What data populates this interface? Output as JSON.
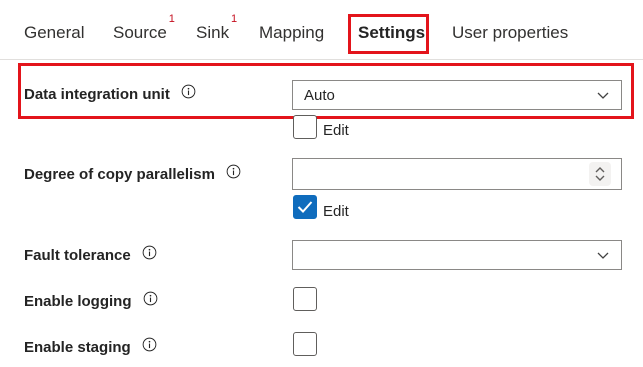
{
  "tabs": [
    {
      "label": "General",
      "badge": ""
    },
    {
      "label": "Source",
      "badge": "1"
    },
    {
      "label": "Sink",
      "badge": "1"
    },
    {
      "label": "Mapping",
      "badge": ""
    },
    {
      "label": "Settings",
      "badge": ""
    },
    {
      "label": "User properties",
      "badge": ""
    }
  ],
  "active_tab": "Settings",
  "fields": {
    "diu": {
      "label": "Data integration unit",
      "value": "Auto",
      "edit_label": "Edit",
      "edit_checked": false
    },
    "parallelism": {
      "label": "Degree of copy parallelism",
      "value": "",
      "edit_label": "Edit",
      "edit_checked": true
    },
    "fault_tolerance": {
      "label": "Fault tolerance",
      "value": ""
    },
    "logging": {
      "label": "Enable logging",
      "checked": false
    },
    "staging": {
      "label": "Enable staging",
      "checked": false
    }
  },
  "icons": {
    "info": "info-icon",
    "chevron": "chevron-down-icon",
    "spinner": "spin-updown-icon",
    "check": "checkmark-icon"
  },
  "colors": {
    "highlight": "#e3141b",
    "accent": "#0f6cbd",
    "badge": "#c50f1f",
    "border": "#8a8886"
  }
}
